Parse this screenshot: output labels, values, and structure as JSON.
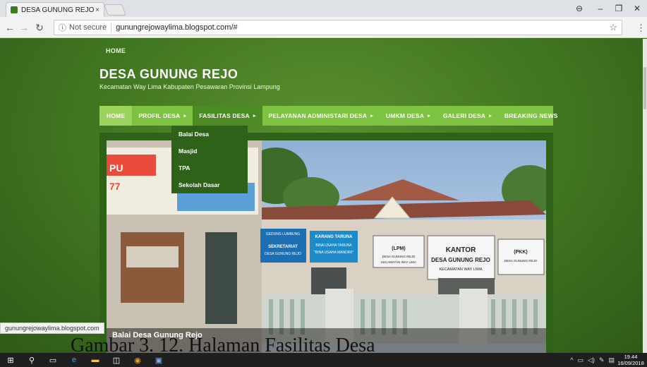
{
  "browser": {
    "tab_title": "DESA GUNUNG REJO",
    "tab_close": "×",
    "url_secure_label": "Not secure",
    "url": "gunungrejowaylima.blogspot.com/#",
    "status_url": "gunungrejowaylima.blogspot.com"
  },
  "site": {
    "breadcrumb": "HOME",
    "title": "DESA GUNUNG REJO",
    "subtitle": "Kecamatan Way Lima Kabupaten Pesawaran Provinsi Lampung",
    "menu": [
      {
        "label": "HOME",
        "arrow": ""
      },
      {
        "label": "PROFIL DESA",
        "arrow": "▸"
      },
      {
        "label": "FASILITAS DESA",
        "arrow": "▸"
      },
      {
        "label": "PELAYANAN ADMINISTARI DESA",
        "arrow": "▸"
      },
      {
        "label": "UMKM DESA",
        "arrow": "▸"
      },
      {
        "label": "GALERI DESA",
        "arrow": "▸"
      },
      {
        "label": "BREAKING NEWS",
        "arrow": ""
      }
    ],
    "dropdown": [
      "Balai Desa",
      "Masjid",
      "TPA",
      "Sekolah Dasar"
    ],
    "slide_caption": "Balai Desa Gunung Rejo",
    "signs": {
      "s1_top": "GEDUNG LUMBUNG",
      "s1_a": "SEKRETARIAT",
      "s1_b": "DESA GUNUNG REJO",
      "s2_a": "KARANG TARUNA",
      "s2_b": "BINA USAHA TARUNA",
      "s2_c": "\"BINA USAHA MANDIRI\"",
      "s3_a": "(LPM)",
      "s3_b": "DESA GUNUNG REJO",
      "s3_c": "KECAMATAN WAY LIMA",
      "s4_a": "KANTOR",
      "s4_b": "DESA GUNUNG REJO",
      "s4_c": "KECAMATAN WAY LIMA",
      "s5_a": "(PKK)",
      "s5_b": "DESA GUNUNG REJO",
      "banner_a": "PU",
      "banner_b": "77"
    }
  },
  "figure_caption": "Gambar 3. 12. Halaman Fasilitas Desa",
  "taskbar": {
    "time": "19.44",
    "date": "16/09/2018"
  },
  "colors": {
    "menu_bg": "#7ec241",
    "menu_active": "#4c8a24",
    "dropdown_bg": "#2f6219",
    "page_bg": "#3f7420"
  }
}
